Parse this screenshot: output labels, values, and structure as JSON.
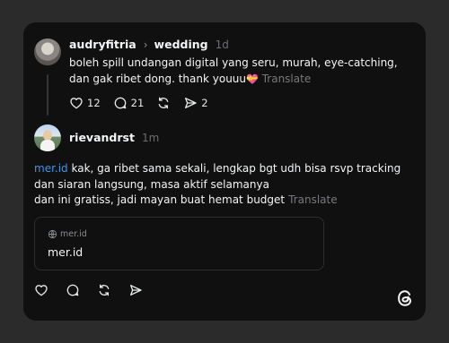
{
  "post": {
    "username": "audryfitria",
    "topic": "wedding",
    "time": "1d",
    "text": "boleh spill undangan digital yang seru, murah, eye-catching, dan gak ribet dong. thank youuu",
    "emoji": "💝",
    "translate": "Translate",
    "likes": "12",
    "replies": "21",
    "shares": "2"
  },
  "reply": {
    "username": "rievandrst",
    "time": "1m",
    "mention": "mer.id",
    "line1": " kak, ga ribet sama sekali, lengkap bgt udh bisa rsvp tracking dan siaran langsung, masa aktif selamanya",
    "line2": "dan ini gratiss, jadi mayan buat hemat budget",
    "translate": "Translate",
    "link_card": {
      "domain": "mer.id",
      "title": "mer.id"
    }
  },
  "icons": {
    "like": "heart-icon",
    "reply": "comment-icon",
    "repost": "repost-icon",
    "share": "send-icon",
    "link": "globe-icon",
    "logo": "threads-logo-icon"
  },
  "colors": {
    "background": "#101010",
    "mention": "#3897f0",
    "muted": "#77797c"
  }
}
